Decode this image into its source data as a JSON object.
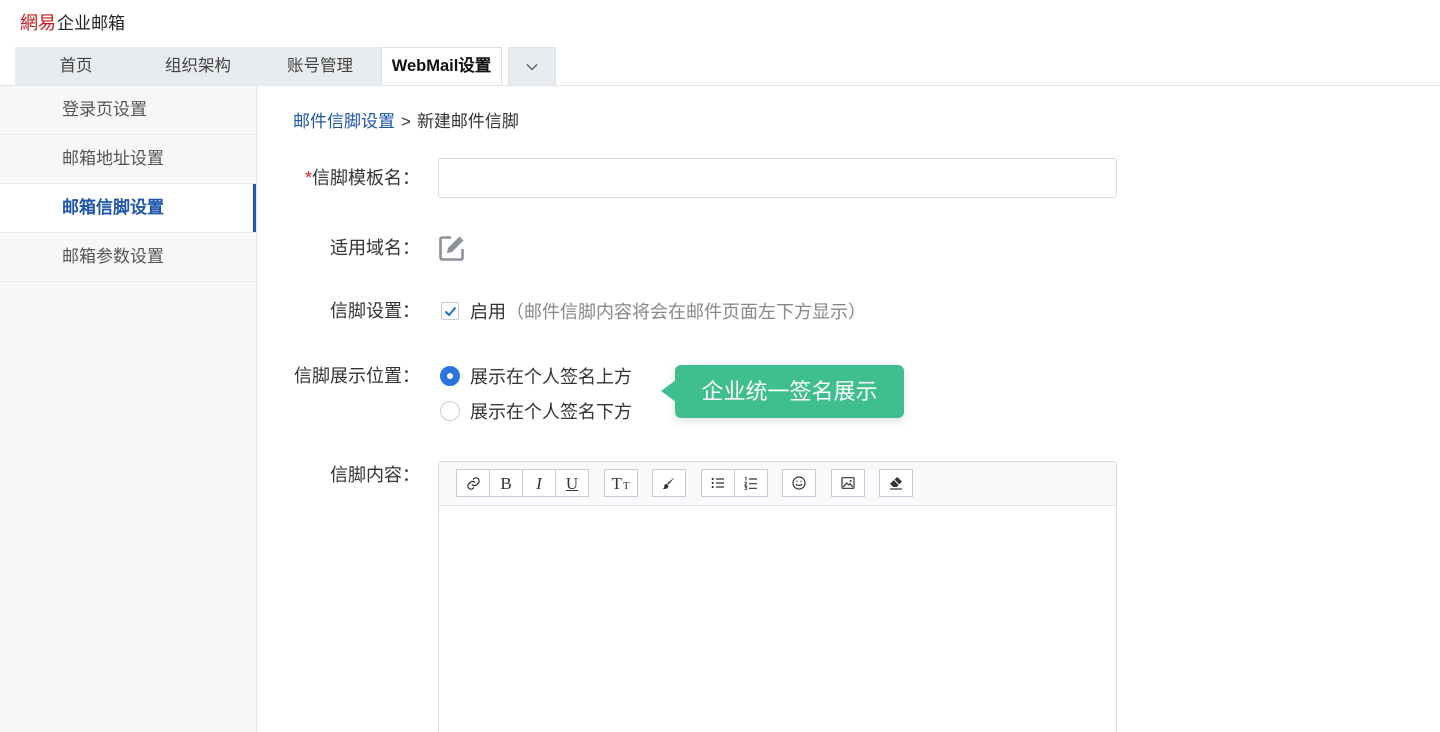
{
  "header": {
    "logo_brand": "網易",
    "logo_product": "企业邮箱"
  },
  "tabs": [
    {
      "label": "首页",
      "active": false
    },
    {
      "label": "组织架构",
      "active": false
    },
    {
      "label": "账号管理",
      "active": false
    },
    {
      "label": "WebMail设置",
      "active": true
    }
  ],
  "tabs_more": {
    "icon": "chevron-down-icon"
  },
  "sidebar": {
    "items": [
      {
        "label": "登录页设置",
        "active": false
      },
      {
        "label": "邮箱地址设置",
        "active": false
      },
      {
        "label": "邮箱信脚设置",
        "active": true
      },
      {
        "label": "邮箱参数设置",
        "active": false
      }
    ]
  },
  "breadcrumb": {
    "parent": "邮件信脚设置",
    "separator": ">",
    "current": "新建邮件信脚"
  },
  "form": {
    "template_name": {
      "required_mark": "*",
      "label": "信脚模板名：",
      "value": ""
    },
    "domain": {
      "label": "适用域名：",
      "icon": "edit-icon"
    },
    "footer_setting": {
      "label": "信脚设置：",
      "checkbox_label": "启用",
      "checked": true,
      "hint": "（邮件信脚内容将会在邮件页面左下方显示）"
    },
    "position": {
      "label": "信脚展示位置：",
      "options": [
        {
          "label": "展示在个人签名上方",
          "selected": true
        },
        {
          "label": "展示在个人签名下方",
          "selected": false
        }
      ]
    },
    "content": {
      "label": "信脚内容：",
      "value": ""
    }
  },
  "tooltip": {
    "text": "企业统一签名展示"
  },
  "editor": {
    "toolbar": [
      [
        {
          "icon": "link-icon"
        },
        {
          "icon": "bold-icon",
          "glyph": "B"
        },
        {
          "icon": "italic-icon",
          "glyph": "I"
        },
        {
          "icon": "underline-icon",
          "glyph": "U"
        }
      ],
      [
        {
          "icon": "font-size-icon",
          "glyph": "T",
          "glyph_small": "T"
        }
      ],
      [
        {
          "icon": "brush-icon"
        }
      ],
      [
        {
          "icon": "bullet-list-icon"
        },
        {
          "icon": "numbered-list-icon"
        }
      ],
      [
        {
          "icon": "emoji-icon"
        }
      ],
      [
        {
          "icon": "image-icon"
        }
      ],
      [
        {
          "icon": "eraser-icon"
        }
      ]
    ]
  },
  "colors": {
    "brand": "#c41a20",
    "accent": "#1f56ad",
    "tooltip": "#3fbf8f",
    "checkbox": "#1f6ddc",
    "radio": "#2d74de"
  }
}
